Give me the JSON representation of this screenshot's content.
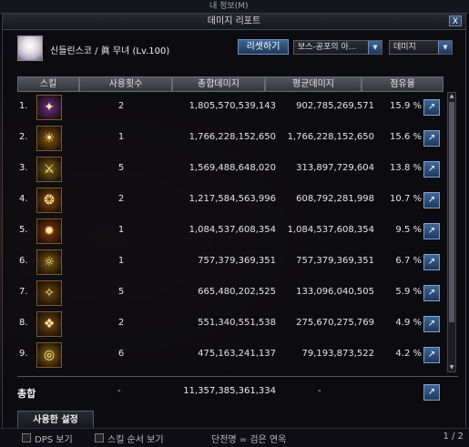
{
  "background": {
    "top_label": "내 정보(M)"
  },
  "window": {
    "title": "데미지 리포트",
    "close_label": "X"
  },
  "header": {
    "character": "신들린스코 / 眞 무녀 (Lv.100)",
    "reset_label": "리셋하기",
    "boss_select": "보스-공포의 아...",
    "metric_select": "데미지"
  },
  "columns": {
    "skill": "스킬",
    "uses": "사용횟수",
    "total": "총합데미지",
    "avg": "평균데미지",
    "share": "점유율"
  },
  "rows": [
    {
      "num": "1.",
      "uses": "2",
      "total": "1,805,570,539,143",
      "avg": "902,785,269,571",
      "share": "15.9 %",
      "icon": "skill-1-icon",
      "glyph": "✦",
      "color": "#6a2f8e"
    },
    {
      "num": "2.",
      "uses": "1",
      "total": "1,766,228,152,650",
      "avg": "1,766,228,152,650",
      "share": "15.6 %",
      "icon": "skill-2-icon",
      "glyph": "☀",
      "color": "#8a5a10"
    },
    {
      "num": "3.",
      "uses": "5",
      "total": "1,569,488,648,020",
      "avg": "313,897,729,604",
      "share": "13.8 %",
      "icon": "skill-3-icon",
      "glyph": "⚔",
      "color": "#7a6418"
    },
    {
      "num": "4.",
      "uses": "2",
      "total": "1,217,584,563,996",
      "avg": "608,792,281,998",
      "share": "10.7 %",
      "icon": "skill-4-icon",
      "glyph": "❂",
      "color": "#8a4a10"
    },
    {
      "num": "5.",
      "uses": "1",
      "total": "1,084,537,608,354",
      "avg": "1,084,537,608,354",
      "share": "9.5 %",
      "icon": "skill-5-icon",
      "glyph": "✹",
      "color": "#8a3a10"
    },
    {
      "num": "6.",
      "uses": "1",
      "total": "757,379,369,351",
      "avg": "757,379,369,351",
      "share": "6.7 %",
      "icon": "skill-6-icon",
      "glyph": "☼",
      "color": "#7a5a14"
    },
    {
      "num": "7.",
      "uses": "5",
      "total": "665,480,202,525",
      "avg": "133,096,040,505",
      "share": "5.9 %",
      "icon": "skill-7-icon",
      "glyph": "✧",
      "color": "#6a4a10"
    },
    {
      "num": "8.",
      "uses": "2",
      "total": "551,340,551,538",
      "avg": "275,670,275,769",
      "share": "4.9 %",
      "icon": "skill-8-icon",
      "glyph": "❖",
      "color": "#7a4a18"
    },
    {
      "num": "9.",
      "uses": "6",
      "total": "475,163,241,137",
      "avg": "79,193,873,522",
      "share": "4.2 %",
      "icon": "skill-9-icon",
      "glyph": "◎",
      "color": "#8a6a14"
    }
  ],
  "total_row": {
    "label": "총합",
    "uses": "-",
    "total": "11,357,385,361,334",
    "avg": "-"
  },
  "used_settings_tab": "사용한 설정",
  "bottom": {
    "dps_label": "DPS 보기",
    "skill_order_label": "스킬 순서 보기",
    "legend": "단전명 = 검은 연옥",
    "page": "1 / 2"
  }
}
